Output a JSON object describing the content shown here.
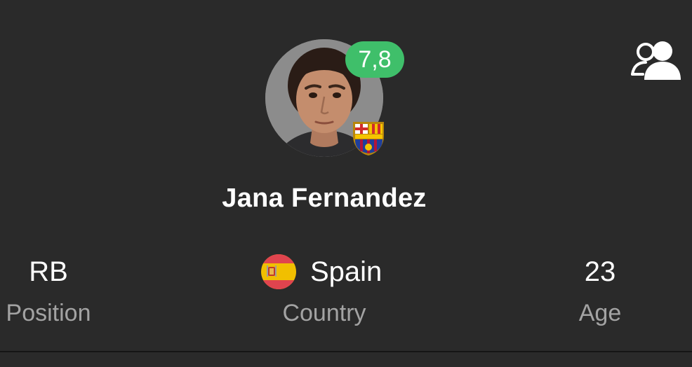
{
  "player": {
    "name": "Jana Fernandez",
    "rating": "7,8",
    "rating_color": "#3fbf6a",
    "avatar_icon": "player-photo",
    "club_icon": "fc-barcelona-crest"
  },
  "header": {
    "compare_icon": "people-icon"
  },
  "stats": {
    "position": {
      "value": "RB",
      "label": "Position"
    },
    "country": {
      "value": "Spain",
      "label": "Country",
      "flag_icon": "spain-flag-icon"
    },
    "age": {
      "value": "23",
      "label": "Age"
    }
  },
  "colors": {
    "background": "#2a2a2a",
    "label": "#a3a3a3",
    "text": "#ffffff"
  }
}
